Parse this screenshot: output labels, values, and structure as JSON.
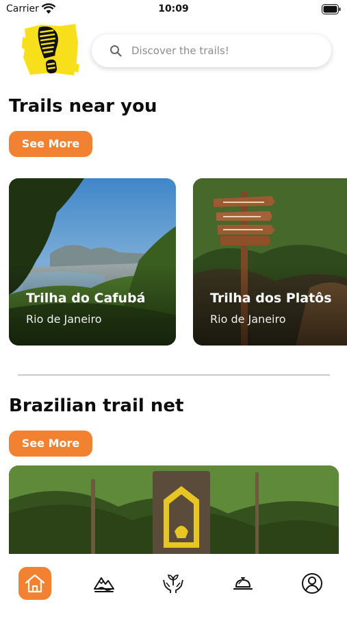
{
  "status_bar": {
    "carrier": "Carrier",
    "time": "10:09"
  },
  "search": {
    "placeholder": "Discover the trails!"
  },
  "sections": {
    "near_you": {
      "title": "Trails near you",
      "see_more_label": "See More",
      "cards": [
        {
          "title": "Trilha do Cafubá",
          "location": "Rio de Janeiro"
        },
        {
          "title": "Trilha dos Platôs",
          "location": "Rio de Janeiro"
        }
      ]
    },
    "brazilian_net": {
      "title": "Brazilian trail net",
      "see_more_label": "See More"
    }
  },
  "tab_bar": {
    "items": [
      {
        "icon": "home-icon",
        "active": true
      },
      {
        "icon": "mountain-icon",
        "active": false
      },
      {
        "icon": "hands-plant-icon",
        "active": false
      },
      {
        "icon": "service-bell-icon",
        "active": false
      },
      {
        "icon": "user-icon",
        "active": false
      }
    ]
  },
  "colors": {
    "accent": "#f28232",
    "logo_yellow": "#f7e01b"
  }
}
